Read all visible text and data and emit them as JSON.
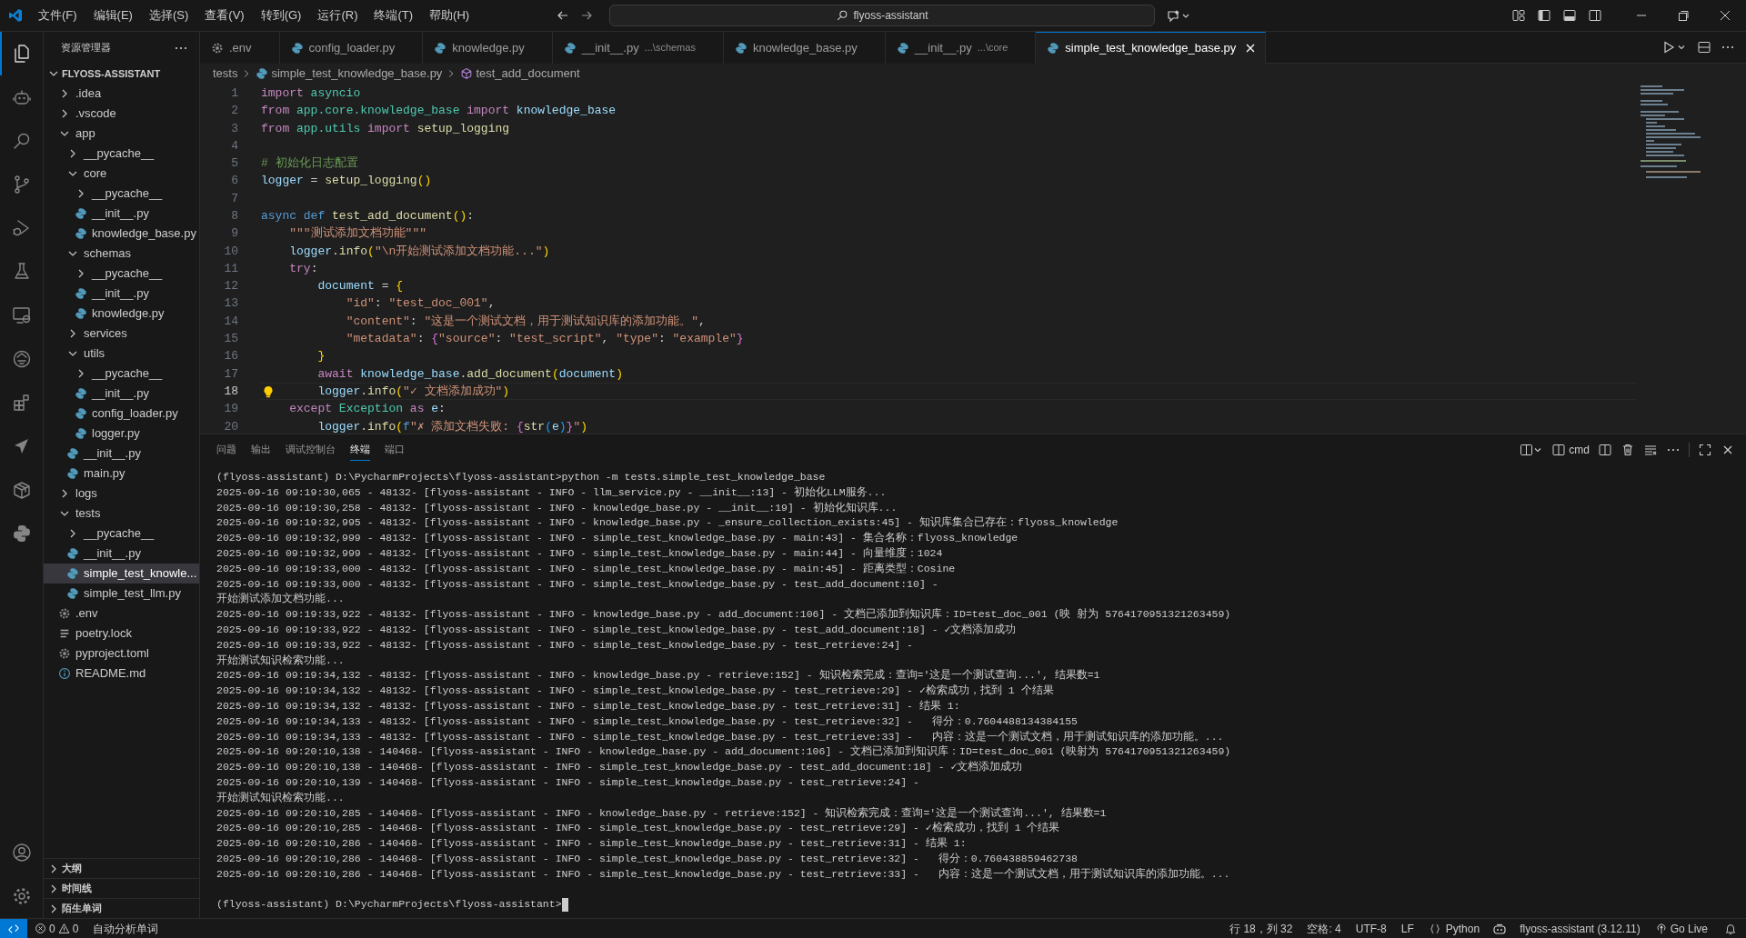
{
  "title_bar": {
    "menus": [
      "文件(F)",
      "编辑(E)",
      "选择(S)",
      "查看(V)",
      "转到(G)",
      "运行(R)",
      "终端(T)",
      "帮助(H)"
    ],
    "search": "flyoss-assistant"
  },
  "activity_bar": {
    "top": [
      {
        "kind": "files",
        "selected": true
      },
      {
        "kind": "robot",
        "selected": false
      },
      {
        "kind": "search",
        "selected": false
      },
      {
        "kind": "branch",
        "selected": false
      },
      {
        "kind": "debug",
        "selected": false
      },
      {
        "kind": "flask",
        "selected": false
      },
      {
        "kind": "remote",
        "selected": false
      },
      {
        "kind": "cloud",
        "selected": false
      },
      {
        "kind": "extensions",
        "selected": false
      },
      {
        "kind": "plane",
        "selected": false
      },
      {
        "kind": "box",
        "selected": false
      },
      {
        "kind": "python",
        "selected": false
      }
    ],
    "bottom": [
      {
        "kind": "account",
        "selected": false
      },
      {
        "kind": "settings",
        "selected": false
      }
    ]
  },
  "sidebar": {
    "title": "资源管理器",
    "root": {
      "label": "FLYOSS-ASSISTANT",
      "expanded": true
    },
    "tree": [
      {
        "label": ".idea",
        "kind": "folder",
        "expanded": false,
        "selected": false
      },
      {
        "label": ".vscode",
        "kind": "folder",
        "expanded": false,
        "selected": false
      },
      {
        "label": "app",
        "kind": "folder",
        "expanded": true,
        "selected": false,
        "children": [
          {
            "label": "__pycache__",
            "kind": "folder",
            "expanded": false,
            "selected": false
          },
          {
            "label": "core",
            "kind": "folder",
            "expanded": true,
            "selected": false,
            "children": [
              {
                "label": "__pycache__",
                "kind": "folder",
                "expanded": false,
                "selected": false
              },
              {
                "label": "__init__.py",
                "kind": "python",
                "selected": false
              },
              {
                "label": "knowledge_base.py",
                "kind": "python",
                "selected": false
              }
            ]
          },
          {
            "label": "schemas",
            "kind": "folder",
            "expanded": true,
            "selected": false,
            "children": [
              {
                "label": "__pycache__",
                "kind": "folder",
                "expanded": false,
                "selected": false
              },
              {
                "label": "__init__.py",
                "kind": "python",
                "selected": false
              },
              {
                "label": "knowledge.py",
                "kind": "python",
                "selected": false
              }
            ]
          },
          {
            "label": "services",
            "kind": "folder",
            "expanded": false,
            "selected": false
          },
          {
            "label": "utils",
            "kind": "folder",
            "expanded": true,
            "selected": false,
            "children": [
              {
                "label": "__pycache__",
                "kind": "folder",
                "expanded": false,
                "selected": false
              },
              {
                "label": "__init__.py",
                "kind": "python",
                "selected": false
              },
              {
                "label": "config_loader.py",
                "kind": "python",
                "selected": false
              },
              {
                "label": "logger.py",
                "kind": "python",
                "selected": false
              }
            ]
          },
          {
            "label": "__init__.py",
            "kind": "python",
            "selected": false
          },
          {
            "label": "main.py",
            "kind": "python",
            "selected": false
          }
        ]
      },
      {
        "label": "logs",
        "kind": "folder",
        "expanded": false,
        "selected": false
      },
      {
        "label": "tests",
        "kind": "folder",
        "expanded": true,
        "selected": false,
        "children": [
          {
            "label": "__pycache__",
            "kind": "folder",
            "expanded": false,
            "selected": false
          },
          {
            "label": "__init__.py",
            "kind": "python",
            "selected": false
          },
          {
            "label": "simple_test_knowle...",
            "kind": "python",
            "selected": true
          },
          {
            "label": "simple_test_llm.py",
            "kind": "python",
            "selected": false
          }
        ]
      },
      {
        "label": ".env",
        "kind": "gear",
        "selected": false
      },
      {
        "label": "poetry.lock",
        "kind": "lines",
        "selected": false
      },
      {
        "label": "pyproject.toml",
        "kind": "gear",
        "selected": false
      },
      {
        "label": "README.md",
        "kind": "info",
        "selected": false
      }
    ],
    "sections": [
      {
        "label": "大纲",
        "expanded": false
      },
      {
        "label": "时间线",
        "expanded": false
      },
      {
        "label": "陌生单词",
        "expanded": false
      }
    ]
  },
  "tabs": [
    {
      "label": ".env",
      "kind": "gear",
      "selected": false
    },
    {
      "label": "config_loader.py",
      "kind": "python",
      "selected": false
    },
    {
      "label": "knowledge.py",
      "kind": "python",
      "selected": false
    },
    {
      "label": "__init__.py",
      "description": "...\\schemas",
      "kind": "python",
      "selected": false
    },
    {
      "label": "knowledge_base.py",
      "kind": "python",
      "selected": false
    },
    {
      "label": "__init__.py",
      "description": "...\\core",
      "kind": "python",
      "selected": false
    },
    {
      "label": "simple_test_knowledge_base.py",
      "kind": "python",
      "selected": true
    }
  ],
  "breadcrumb": {
    "folder": "tests",
    "file": "simple_test_knowledge_base.py",
    "symbol": "test_add_document"
  },
  "editor": {
    "lines": [
      {
        "number": "1",
        "current": false,
        "lightbulb": false,
        "tokens": [
          {
            "kind": "kw",
            "text": "import"
          },
          {
            "kind": "type",
            "text": " asyncio"
          }
        ]
      },
      {
        "number": "2",
        "current": false,
        "lightbulb": false,
        "tokens": [
          {
            "kind": "kw",
            "text": "from"
          },
          {
            "kind": "type",
            "text": " app.core.knowledge_base"
          },
          {
            "kind": "kw",
            "text": " import"
          },
          {
            "kind": "var",
            "text": " knowledge_base"
          }
        ]
      },
      {
        "number": "3",
        "current": false,
        "lightbulb": false,
        "tokens": [
          {
            "kind": "kw",
            "text": "from"
          },
          {
            "kind": "type",
            "text": " app.utils"
          },
          {
            "kind": "kw",
            "text": " import"
          },
          {
            "kind": "fn",
            "text": " setup_logging"
          }
        ]
      },
      {
        "number": "4",
        "current": false,
        "lightbulb": false
      },
      {
        "number": "5",
        "current": false,
        "lightbulb": false,
        "tokens": [
          {
            "kind": "comment",
            "text": "# 初始化日志配置"
          }
        ]
      },
      {
        "number": "6",
        "current": false,
        "lightbulb": false,
        "tokens": [
          {
            "kind": "var",
            "text": "logger"
          },
          {
            "kind": "plain",
            "text": " = "
          },
          {
            "kind": "fn",
            "text": "setup_logging"
          },
          {
            "kind": "br1",
            "text": "()"
          }
        ]
      },
      {
        "number": "7",
        "current": false,
        "lightbulb": false
      },
      {
        "number": "8",
        "current": false,
        "lightbulb": false,
        "tokens": [
          {
            "kind": "storage",
            "text": "async"
          },
          {
            "kind": "storage",
            "text": " def"
          },
          {
            "kind": "fn",
            "text": " test_add_document"
          },
          {
            "kind": "br1",
            "text": "()"
          },
          {
            "kind": "plain",
            "text": ":"
          }
        ]
      },
      {
        "number": "9",
        "current": false,
        "lightbulb": false,
        "tokens": [
          {
            "kind": "str",
            "text": "    \"\"\"测试添加文档功能\"\"\""
          }
        ]
      },
      {
        "number": "10",
        "current": false,
        "lightbulb": false,
        "tokens": [
          {
            "kind": "var",
            "text": "    logger"
          },
          {
            "kind": "plain",
            "text": "."
          },
          {
            "kind": "fn",
            "text": "info"
          },
          {
            "kind": "br1",
            "text": "("
          },
          {
            "kind": "str",
            "text": "\"\\n开始测试添加文档功能...\""
          },
          {
            "kind": "br1",
            "text": ")"
          }
        ]
      },
      {
        "number": "11",
        "current": false,
        "lightbulb": false,
        "tokens": [
          {
            "kind": "kw",
            "text": "    try"
          },
          {
            "kind": "plain",
            "text": ":"
          }
        ]
      },
      {
        "number": "12",
        "current": false,
        "lightbulb": false,
        "tokens": [
          {
            "kind": "var",
            "text": "        document"
          },
          {
            "kind": "plain",
            "text": " = "
          },
          {
            "kind": "br1",
            "text": "{"
          }
        ]
      },
      {
        "number": "13",
        "current": false,
        "lightbulb": false,
        "tokens": [
          {
            "kind": "str",
            "text": "            \"id\""
          },
          {
            "kind": "plain",
            "text": ": "
          },
          {
            "kind": "str",
            "text": "\"test_doc_001\""
          },
          {
            "kind": "plain",
            "text": ","
          }
        ]
      },
      {
        "number": "14",
        "current": false,
        "lightbulb": false,
        "tokens": [
          {
            "kind": "str",
            "text": "            \"content\""
          },
          {
            "kind": "plain",
            "text": ": "
          },
          {
            "kind": "str",
            "text": "\"这是一个测试文档，用于测试知识库的添加功能。\""
          },
          {
            "kind": "plain",
            "text": ","
          }
        ]
      },
      {
        "number": "15",
        "current": false,
        "lightbulb": false,
        "tokens": [
          {
            "kind": "str",
            "text": "            \"metadata\""
          },
          {
            "kind": "plain",
            "text": ": "
          },
          {
            "kind": "br2",
            "text": "{"
          },
          {
            "kind": "str",
            "text": "\"source\""
          },
          {
            "kind": "plain",
            "text": ": "
          },
          {
            "kind": "str",
            "text": "\"test_script\""
          },
          {
            "kind": "plain",
            "text": ", "
          },
          {
            "kind": "str",
            "text": "\"type\""
          },
          {
            "kind": "plain",
            "text": ": "
          },
          {
            "kind": "str",
            "text": "\"example\""
          },
          {
            "kind": "br2",
            "text": "}"
          }
        ]
      },
      {
        "number": "16",
        "current": false,
        "lightbulb": false,
        "tokens": [
          {
            "kind": "br1",
            "text": "        }"
          }
        ]
      },
      {
        "number": "17",
        "current": false,
        "lightbulb": false,
        "tokens": [
          {
            "kind": "kw",
            "text": "        await"
          },
          {
            "kind": "var",
            "text": " knowledge_base"
          },
          {
            "kind": "plain",
            "text": "."
          },
          {
            "kind": "fn",
            "text": "add_document"
          },
          {
            "kind": "br1",
            "text": "("
          },
          {
            "kind": "var",
            "text": "document"
          },
          {
            "kind": "br1",
            "text": ")"
          }
        ]
      },
      {
        "number": "18",
        "current": true,
        "lightbulb": true,
        "tokens": [
          {
            "kind": "var",
            "text": "        logger"
          },
          {
            "kind": "plain",
            "text": "."
          },
          {
            "kind": "fn",
            "text": "info"
          },
          {
            "kind": "br1",
            "text": "("
          },
          {
            "kind": "str",
            "text": "\"✓ 文档添加成功\""
          },
          {
            "kind": "br1",
            "text": ")"
          }
        ]
      },
      {
        "number": "19",
        "current": false,
        "lightbulb": false,
        "tokens": [
          {
            "kind": "kw",
            "text": "    except"
          },
          {
            "kind": "type",
            "text": " Exception"
          },
          {
            "kind": "kw",
            "text": " as"
          },
          {
            "kind": "var",
            "text": " e"
          },
          {
            "kind": "plain",
            "text": ":"
          }
        ]
      },
      {
        "number": "20",
        "current": false,
        "lightbulb": false,
        "tokens": [
          {
            "kind": "var",
            "text": "        logger"
          },
          {
            "kind": "plain",
            "text": "."
          },
          {
            "kind": "fn",
            "text": "info"
          },
          {
            "kind": "br1",
            "text": "("
          },
          {
            "kind": "storage",
            "text": "f"
          },
          {
            "kind": "str",
            "text": "\"✗ 添加文档失败: "
          },
          {
            "kind": "br2",
            "text": "{"
          },
          {
            "kind": "fn",
            "text": "str"
          },
          {
            "kind": "br3",
            "text": "("
          },
          {
            "kind": "var",
            "text": "e"
          },
          {
            "kind": "br3",
            "text": ")"
          },
          {
            "kind": "br2",
            "text": "}"
          },
          {
            "kind": "str",
            "text": "\""
          },
          {
            "kind": "br1",
            "text": ")"
          }
        ]
      }
    ]
  },
  "panel": {
    "tabs": [
      {
        "label": "问题",
        "selected": false
      },
      {
        "label": "输出",
        "selected": false
      },
      {
        "label": "调试控制台",
        "selected": false
      },
      {
        "label": "终端",
        "selected": true
      },
      {
        "label": "端口",
        "selected": false
      }
    ],
    "shell": "cmd",
    "terminal": {
      "lines": [
        "(flyoss-assistant) D:\\PycharmProjects\\flyoss-assistant>python -m tests.simple_test_knowledge_base",
        "2025-09-16 09:19:30,065 - 48132- [flyoss-assistant - INFO - llm_service.py - __init__:13] - 初始化LLM服务...",
        "2025-09-16 09:19:30,258 - 48132- [flyoss-assistant - INFO - knowledge_base.py - __init__:19] - 初始化知识库...",
        "2025-09-16 09:19:32,995 - 48132- [flyoss-assistant - INFO - knowledge_base.py - _ensure_collection_exists:45] - 知识库集合已存在：flyoss_knowledge",
        "2025-09-16 09:19:32,999 - 48132- [flyoss-assistant - INFO - simple_test_knowledge_base.py - main:43] - 集合名称：flyoss_knowledge",
        "2025-09-16 09:19:32,999 - 48132- [flyoss-assistant - INFO - simple_test_knowledge_base.py - main:44] - 向量维度：1024",
        "2025-09-16 09:19:33,000 - 48132- [flyoss-assistant - INFO - simple_test_knowledge_base.py - main:45] - 距离类型：Cosine",
        "2025-09-16 09:19:33,000 - 48132- [flyoss-assistant - INFO - simple_test_knowledge_base.py - test_add_document:10] -",
        "开始测试添加文档功能...",
        "2025-09-16 09:19:33,922 - 48132- [flyoss-assistant - INFO - knowledge_base.py - add_document:106] - 文档已添加到知识库：ID=test_doc_001 (映 射为 5764170951321263459)",
        "2025-09-16 09:19:33,922 - 48132- [flyoss-assistant - INFO - simple_test_knowledge_base.py - test_add_document:18] - ✓文档添加成功",
        "2025-09-16 09:19:33,922 - 48132- [flyoss-assistant - INFO - simple_test_knowledge_base.py - test_retrieve:24] -",
        "开始测试知识检索功能...",
        "2025-09-16 09:19:34,132 - 48132- [flyoss-assistant - INFO - knowledge_base.py - retrieve:152] - 知识检索完成：查询='这是一个测试查询...', 结果数=1",
        "2025-09-16 09:19:34,132 - 48132- [flyoss-assistant - INFO - simple_test_knowledge_base.py - test_retrieve:29] - ✓检索成功，找到 1 个结果",
        "2025-09-16 09:19:34,132 - 48132- [flyoss-assistant - INFO - simple_test_knowledge_base.py - test_retrieve:31] - 结果 1:",
        "2025-09-16 09:19:34,133 - 48132- [flyoss-assistant - INFO - simple_test_knowledge_base.py - test_retrieve:32] -   得分：0.7604488134384155",
        "2025-09-16 09:19:34,133 - 48132- [flyoss-assistant - INFO - simple_test_knowledge_base.py - test_retrieve:33] -   内容：这是一个测试文档，用于测试知识库的添加功能。...",
        "2025-09-16 09:20:10,138 - 140468- [flyoss-assistant - INFO - knowledge_base.py - add_document:106] - 文档已添加到知识库：ID=test_doc_001 (映射为 5764170951321263459)",
        "2025-09-16 09:20:10,138 - 140468- [flyoss-assistant - INFO - simple_test_knowledge_base.py - test_add_document:18] - ✓文档添加成功",
        "2025-09-16 09:20:10,139 - 140468- [flyoss-assistant - INFO - simple_test_knowledge_base.py - test_retrieve:24] -",
        "开始测试知识检索功能...",
        "2025-09-16 09:20:10,285 - 140468- [flyoss-assistant - INFO - knowledge_base.py - retrieve:152] - 知识检索完成：查询='这是一个测试查询...', 结果数=1",
        "2025-09-16 09:20:10,285 - 140468- [flyoss-assistant - INFO - simple_test_knowledge_base.py - test_retrieve:29] - ✓检索成功，找到 1 个结果",
        "2025-09-16 09:20:10,286 - 140468- [flyoss-assistant - INFO - simple_test_knowledge_base.py - test_retrieve:31] - 结果 1:",
        "2025-09-16 09:20:10,286 - 140468- [flyoss-assistant - INFO - simple_test_knowledge_base.py - test_retrieve:32] -   得分：0.760438859462738",
        "2025-09-16 09:20:10,286 - 140468- [flyoss-assistant - INFO - simple_test_knowledge_base.py - test_retrieve:33] -   内容：这是一个测试文档，用于测试知识库的添加功能。..."
      ],
      "prompt": "(flyoss-assistant) D:\\PycharmProjects\\flyoss-assistant>"
    }
  },
  "status_bar": {
    "errors": "0",
    "warnings": "0",
    "extension": "自动分析单词",
    "position": "行 18，列 32",
    "indent": "空格: 4",
    "encoding": "UTF-8",
    "eol": "LF",
    "language": "Python",
    "interpreter": "flyoss-assistant (3.12.11)",
    "live": "Go Live"
  }
}
